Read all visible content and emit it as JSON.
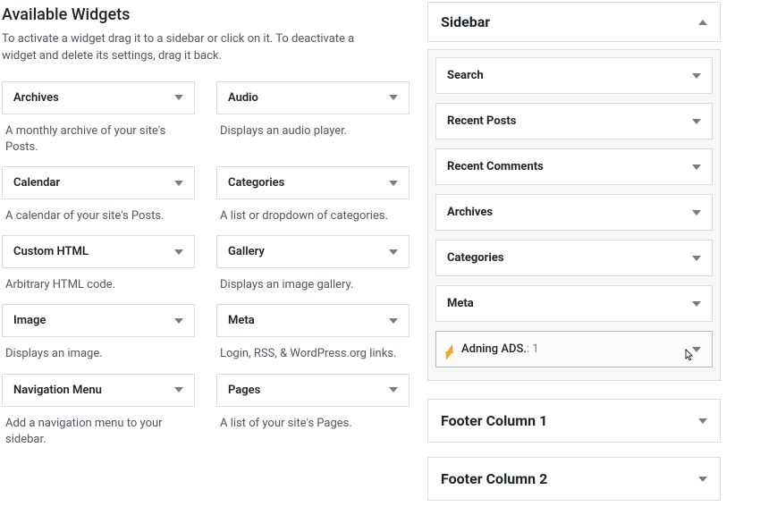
{
  "heading": "Available Widgets",
  "subtext": "To activate a widget drag it to a sidebar or click on it. To deactivate a widget and delete its settings, drag it back.",
  "available": [
    {
      "title": "Archives",
      "desc": "A monthly archive of your site's Posts."
    },
    {
      "title": "Audio",
      "desc": "Displays an audio player."
    },
    {
      "title": "Calendar",
      "desc": "A calendar of your site's Posts."
    },
    {
      "title": "Categories",
      "desc": "A list or dropdown of categories."
    },
    {
      "title": "Custom HTML",
      "desc": "Arbitrary HTML code."
    },
    {
      "title": "Gallery",
      "desc": "Displays an image gallery."
    },
    {
      "title": "Image",
      "desc": "Displays an image."
    },
    {
      "title": "Meta",
      "desc": "Login, RSS, & WordPress.org links."
    },
    {
      "title": "Navigation Menu",
      "desc": "Add a navigation menu to your sidebar."
    },
    {
      "title": "Pages",
      "desc": "A list of your site's Pages."
    }
  ],
  "sidebar_area": {
    "title": "Sidebar",
    "widgets": [
      {
        "title": "Search"
      },
      {
        "title": "Recent Posts"
      },
      {
        "title": "Recent Comments"
      },
      {
        "title": "Archives"
      },
      {
        "title": "Categories"
      },
      {
        "title": "Meta"
      }
    ],
    "special": {
      "title": "Adning ADS.",
      "suffix": ": 1"
    }
  },
  "collapsed_areas": [
    {
      "title": "Footer Column 1"
    },
    {
      "title": "Footer Column 2"
    }
  ]
}
